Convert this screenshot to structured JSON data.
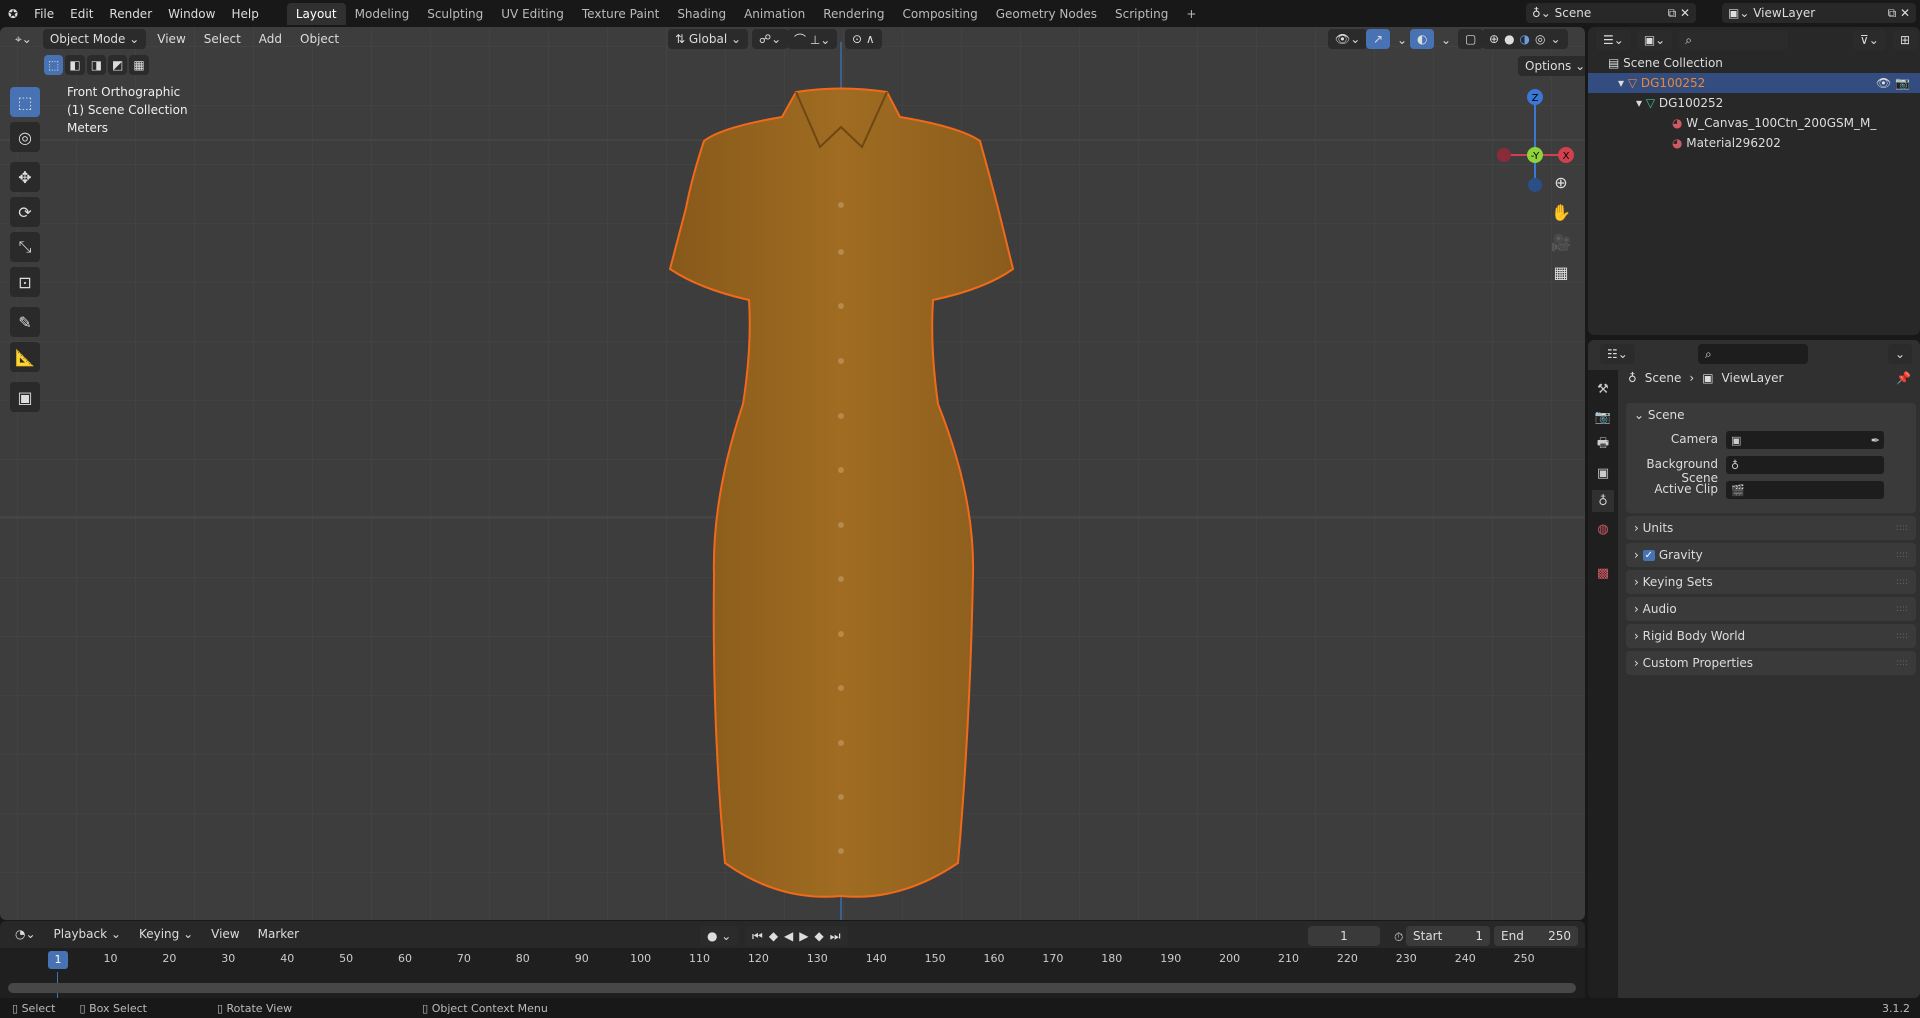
{
  "menu": [
    "File",
    "Edit",
    "Render",
    "Window",
    "Help"
  ],
  "workspaces": [
    "Layout",
    "Modeling",
    "Sculpting",
    "UV Editing",
    "Texture Paint",
    "Shading",
    "Animation",
    "Rendering",
    "Compositing",
    "Geometry Nodes",
    "Scripting"
  ],
  "active_workspace": "Layout",
  "scene_selector": "Scene",
  "viewlayer_selector": "ViewLayer",
  "viewport": {
    "mode": "Object Mode",
    "menus": [
      "View",
      "Select",
      "Add",
      "Object"
    ],
    "orientation": "Global",
    "options": "Options",
    "overlay": [
      "Front Orthographic",
      "(1) Scene Collection",
      "Meters"
    ],
    "gizmo": {
      "z": "Z",
      "y": "-Y",
      "x": "X"
    },
    "object_color": "#9c6a21",
    "outline_color": "#f06a1a"
  },
  "outliner": {
    "root": "Scene Collection",
    "items": [
      {
        "label": "DG100252",
        "type": "object",
        "selected": true
      },
      {
        "label": "DG100252",
        "type": "mesh"
      },
      {
        "label": "W_Canvas_100Ctn_200GSM_M_",
        "type": "material"
      },
      {
        "label": "Material296202",
        "type": "material"
      }
    ]
  },
  "properties": {
    "breadcrumb": [
      "Scene",
      "ViewLayer"
    ],
    "scene_panel": {
      "title": "Scene",
      "fields": [
        {
          "label": "Camera",
          "value": ""
        },
        {
          "label": "Background Scene",
          "value": ""
        },
        {
          "label": "Active Clip",
          "value": ""
        }
      ]
    },
    "panels": [
      {
        "title": "Units"
      },
      {
        "title": "Gravity",
        "checked": true
      },
      {
        "title": "Keying Sets"
      },
      {
        "title": "Audio"
      },
      {
        "title": "Rigid Body World"
      },
      {
        "title": "Custom Properties"
      }
    ]
  },
  "timeline": {
    "menus": [
      "Playback",
      "Keying",
      "View",
      "Marker"
    ],
    "current_frame": "1",
    "start_label": "Start",
    "start": "1",
    "end_label": "End",
    "end": "250",
    "ticks": [
      "10",
      "20",
      "30",
      "40",
      "50",
      "60",
      "70",
      "80",
      "90",
      "100",
      "110",
      "120",
      "130",
      "140",
      "150",
      "160",
      "170",
      "180",
      "190",
      "200",
      "210",
      "220",
      "230",
      "240",
      "250"
    ],
    "cursor": "1"
  },
  "status": {
    "select": "Select",
    "box_select": "Box Select",
    "rotate": "Rotate View",
    "context": "Object Context Menu",
    "version": "3.1.2"
  }
}
